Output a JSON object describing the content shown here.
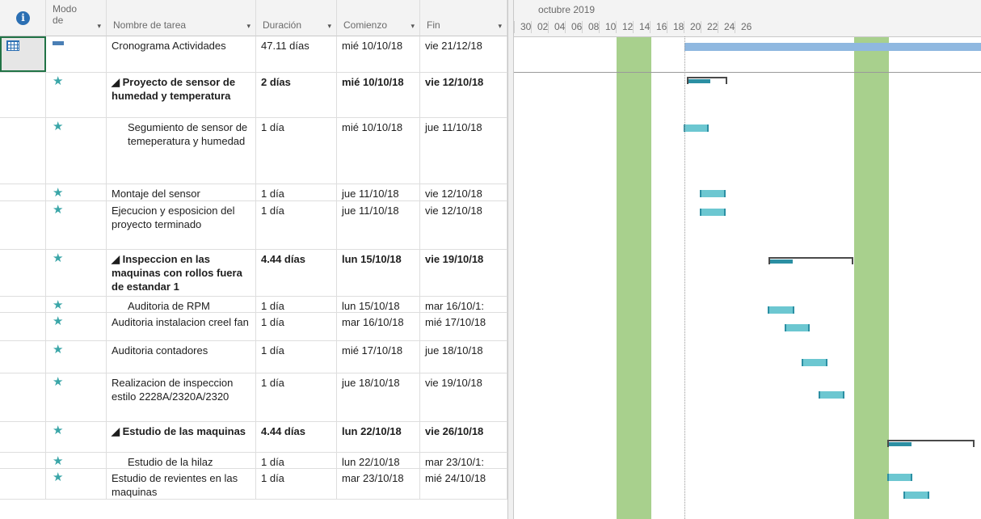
{
  "headers": {
    "info_icon": "i",
    "mode": "Modo de",
    "name": "Nombre de tarea",
    "duration": "Duración",
    "start": "Comienzo",
    "finish": "Fin",
    "dropdown_glyph": "▾"
  },
  "timeline": {
    "month": "octubre 2019",
    "days": [
      "30",
      "02",
      "04",
      "06",
      "08",
      "10",
      "12",
      "14",
      "16",
      "18",
      "20",
      "22",
      "24",
      "26"
    ]
  },
  "tasks": [
    {
      "name": "Cronograma Actividades",
      "duration": "47.11 días",
      "start": "mié 10/10/18",
      "finish": "vie 21/12/18",
      "bold": false,
      "indent": 0
    },
    {
      "name": "◢ Proyecto de sensor de humedad y temperatura",
      "duration": "2 días",
      "start": "mié 10/10/18",
      "finish": "vie 12/10/18",
      "bold": true,
      "indent": 0
    },
    {
      "name": "Segumiento de sensor de temeperatura y humedad",
      "duration": "1 día",
      "start": "mié 10/10/18",
      "finish": "jue 11/10/18",
      "bold": false,
      "indent": 2
    },
    {
      "name": "Montaje del sensor",
      "duration": "1 día",
      "start": "jue 11/10/18",
      "finish": "vie 12/10/18",
      "bold": false,
      "indent": 0
    },
    {
      "name": "Ejecucion y esposicion del proyecto terminado",
      "duration": "1 día",
      "start": "jue 11/10/18",
      "finish": "vie 12/10/18",
      "bold": false,
      "indent": 0
    },
    {
      "name": "◢ Inspeccion en las maquinas con rollos fuera de estandar 1",
      "duration": "4.44 días",
      "start": "lun 15/10/18",
      "finish": "vie 19/10/18",
      "bold": true,
      "indent": 0
    },
    {
      "name": "Auditoria de RPM",
      "duration": "1 día",
      "start": "lun 15/10/18",
      "finish": "mar 16/10/1:",
      "bold": false,
      "indent": 2
    },
    {
      "name": "Auditoria instalacion creel fan",
      "duration": "1 día",
      "start": "mar 16/10/18",
      "finish": "mié 17/10/18",
      "bold": false,
      "indent": 0
    },
    {
      "name": "Auditoria contadores",
      "duration": "1 día",
      "start": "mié 17/10/18",
      "finish": "jue 18/10/18",
      "bold": false,
      "indent": 0
    },
    {
      "name": "Realizacion de inspeccion estilo 2228A/2320A/2320",
      "duration": "1 día",
      "start": "jue 18/10/18",
      "finish": "vie 19/10/18",
      "bold": false,
      "indent": 0
    },
    {
      "name": "◢ Estudio de las maquinas",
      "duration": "4.44 días",
      "start": "lun 22/10/18",
      "finish": "vie 26/10/18",
      "bold": true,
      "indent": 0
    },
    {
      "name": "Estudio de la hilaz",
      "duration": "1 día",
      "start": "lun 22/10/18",
      "finish": "mar 23/10/1:",
      "bold": false,
      "indent": 2
    },
    {
      "name": "Estudio de revientes en las maquinas",
      "duration": "1 día",
      "start": "mar 23/10/18",
      "finish": "mié 24/10/18",
      "bold": false,
      "indent": 0
    }
  ]
}
